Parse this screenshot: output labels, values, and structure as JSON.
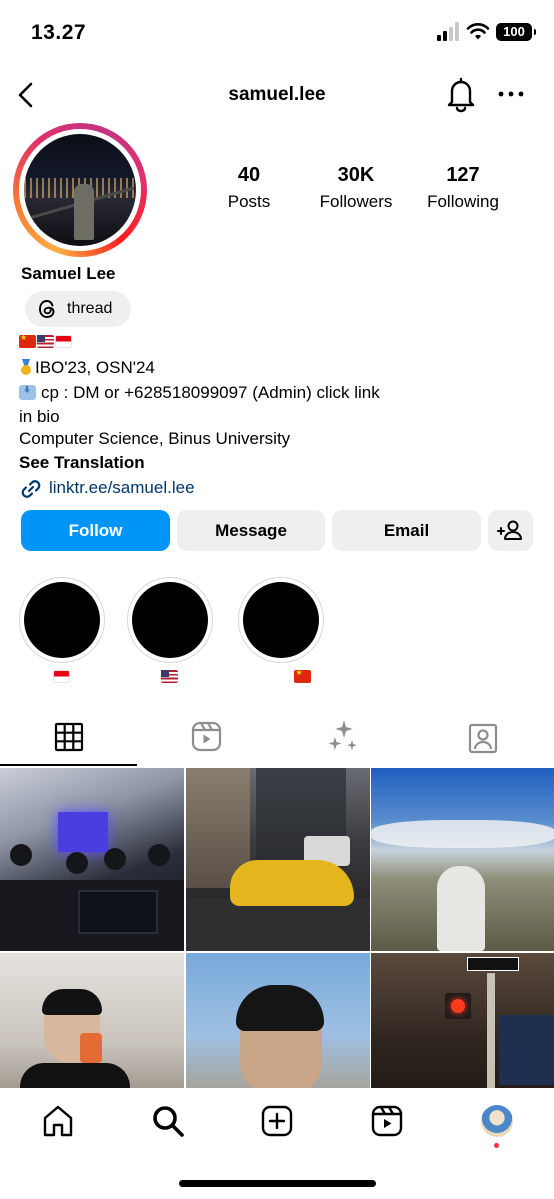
{
  "status_bar": {
    "time": "13.27",
    "battery": "100"
  },
  "header": {
    "username": "samuel.lee"
  },
  "stats": [
    {
      "value": "40",
      "label": "Posts"
    },
    {
      "value": "30K",
      "label": "Followers"
    },
    {
      "value": "127",
      "label": "Following"
    }
  ],
  "profile": {
    "full_name": "Samuel Lee",
    "threads_label": "thread",
    "bio_line_1": "IBO'23, OSN'24",
    "bio_line_2": "cp : DM or +628518099097 (Admin) click link",
    "bio_line_3": "in bio",
    "bio_line_4": "Computer Science, Binus University",
    "see_translation": "See Translation",
    "link": "linktr.ee/samuel.lee"
  },
  "actions": {
    "follow": "Follow",
    "message": "Message",
    "email": "Email"
  },
  "highlights": [
    {
      "flag": "indonesia-flag"
    },
    {
      "flag": "usa-flag"
    },
    {
      "flag": "china-flag"
    }
  ],
  "tabs": [
    "posts-grid",
    "reels",
    "tagged-effects",
    "tagged"
  ],
  "colors": {
    "follow_blue": "#0095f6",
    "link_blue": "#00376b",
    "button_grey": "#efefef",
    "notification_red": "#ff3040"
  },
  "icons": {
    "back": "chevron-left-icon",
    "bell": "bell-icon",
    "more": "more-horizontal-icon",
    "threads": "threads-icon",
    "link": "link-icon",
    "add_user": "add-user-icon",
    "nav": [
      "home-icon",
      "search-icon",
      "create-icon",
      "reels-icon",
      "profile-avatar"
    ]
  }
}
